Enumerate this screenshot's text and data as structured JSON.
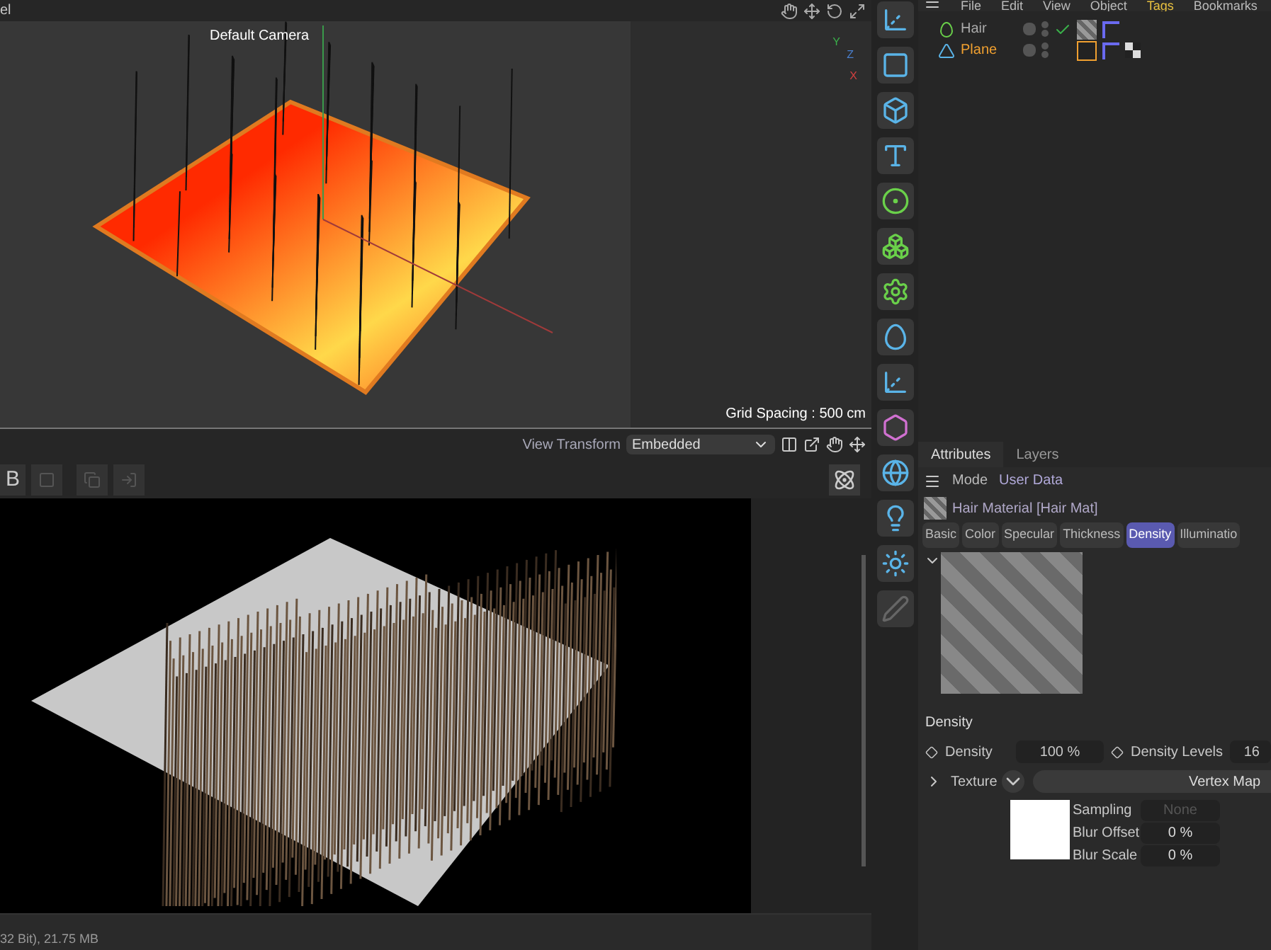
{
  "viewport": {
    "title": "el",
    "camera": "Default Camera",
    "grid_spacing": "Grid Spacing : 500 cm",
    "axes": [
      "Y",
      "Z",
      "X"
    ]
  },
  "view_bar": {
    "label": "View Transform",
    "value": "Embedded"
  },
  "render_toolbar": {
    "label": "B"
  },
  "status_bar": "32 Bit), 21.75 MB",
  "menu": [
    {
      "label": "File",
      "highlighted": false
    },
    {
      "label": "Edit",
      "highlighted": false
    },
    {
      "label": "View",
      "highlighted": false
    },
    {
      "label": "Object",
      "highlighted": false
    },
    {
      "label": "Tags",
      "highlighted": true
    },
    {
      "label": "Bookmarks",
      "highlighted": false
    }
  ],
  "objects": [
    {
      "name": "Hair",
      "selected": false,
      "enabled": true
    },
    {
      "name": "Plane",
      "selected": true,
      "enabled": false
    }
  ],
  "tabs": [
    {
      "label": "Attributes",
      "selected": true
    },
    {
      "label": "Layers",
      "selected": false
    }
  ],
  "mode_bar": [
    "Mode",
    "User Data"
  ],
  "material": "Hair Material [Hair Mat]",
  "channels": [
    {
      "label": "Basic",
      "selected": false
    },
    {
      "label": "Color",
      "selected": false
    },
    {
      "label": "Specular",
      "selected": false
    },
    {
      "label": "Thickness",
      "selected": false
    },
    {
      "label": "Density",
      "selected": true
    },
    {
      "label": "Illuminatio",
      "selected": false
    }
  ],
  "section": "Density",
  "density": {
    "label": "Density",
    "value": "100 %"
  },
  "density_levels": {
    "label": "Density Levels",
    "value": "16"
  },
  "texture": {
    "label": "Texture",
    "button": "Vertex Map"
  },
  "texture_fields": [
    {
      "label": "Sampling",
      "value": "None",
      "disabled": true
    },
    {
      "label": "Blur Offset",
      "value": "0 %",
      "disabled": false
    },
    {
      "label": "Blur Scale",
      "value": "0 %",
      "disabled": false
    }
  ]
}
